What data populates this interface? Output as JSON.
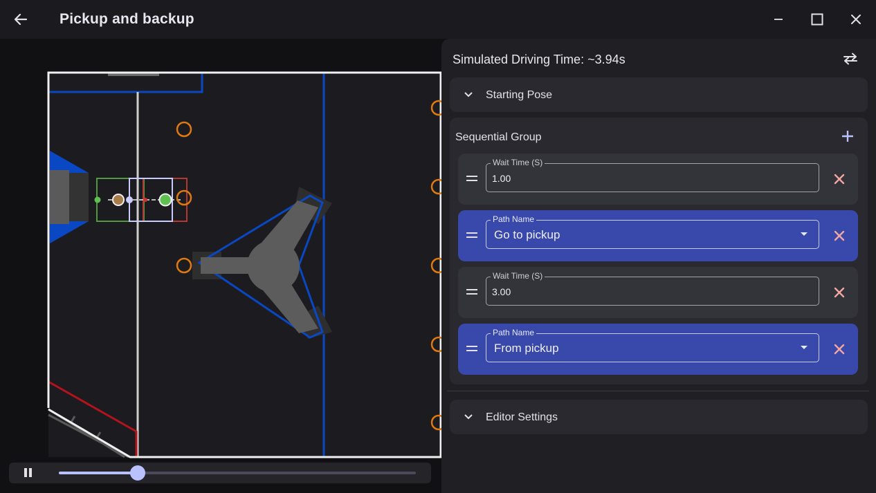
{
  "app": {
    "title": "Pickup and backup"
  },
  "window_controls": [
    "minimize",
    "maximize",
    "close"
  ],
  "panel": {
    "simulated_time": "Simulated Driving Time: ~3.94s",
    "starting_pose_label": "Starting Pose",
    "group_title": "Sequential Group",
    "editor_settings_label": "Editor Settings",
    "commands": [
      {
        "type": "wait",
        "label": "Wait Time (S)",
        "value": "1.00"
      },
      {
        "type": "path",
        "label": "Path Name",
        "value": "Go to pickup"
      },
      {
        "type": "wait",
        "label": "Wait Time (S)",
        "value": "3.00"
      },
      {
        "type": "path",
        "label": "Path Name",
        "value": "From pickup"
      }
    ]
  },
  "playback": {
    "state": "playing",
    "progress": 0.22
  },
  "colors": {
    "accent": "#b9c1ff",
    "path_card": "#3949ab",
    "remove": "#f2a7a0",
    "field_blue": "#0a47c2",
    "field_red": "#b3131c",
    "game_piece": "#e07a10"
  }
}
